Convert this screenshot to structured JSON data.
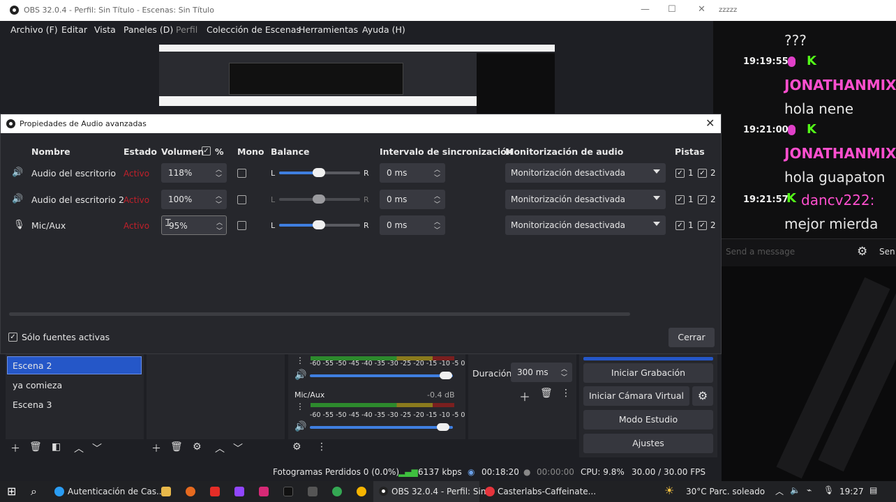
{
  "obs": {
    "title": "OBS 32.0.4 - Perfil: Sin Título - Escenas: Sin Título",
    "menu": [
      "Archivo (F)",
      "Editar",
      "Vista",
      "Paneles (D)",
      "Perfil",
      "Colección de Escenas",
      "Herramientas",
      "Ayuda (H)"
    ]
  },
  "chat": {
    "window_title": "zzzzz",
    "lines": [
      {
        "time": "",
        "user": "",
        "text": "???"
      },
      {
        "time": "19:19:55",
        "user": "JONATHANMIXI",
        "text": "hola nene"
      },
      {
        "time": "19:21:00",
        "user": "JONATHANMIXI",
        "text": "hola guapaton"
      },
      {
        "time": "19:21:57",
        "user": "dancv222:",
        "text": "mejor mierda"
      }
    ],
    "placeholder": "Send a message",
    "send_label": "Sen",
    "user_color": "#ff4fcf",
    "user2_color": "#ff4fcf"
  },
  "dialog": {
    "title": "Propiedades de Audio avanzadas",
    "headers": {
      "name": "Nombre",
      "estado": "Estado",
      "volumen": "Volumen",
      "pct": "%",
      "mono": "Mono",
      "balance": "Balance",
      "sync": "Intervalo de sincronización",
      "monitor": "Monitorización de audio",
      "tracks": "Pistas"
    },
    "rows": [
      {
        "name": "Audio del escritorio",
        "estado": "Activo",
        "volume": "118%",
        "balance_l": "L",
        "balance_r": "R",
        "sync": "0 ms",
        "monitor": "Monitorización desactivada",
        "track1": "1",
        "track2": "2"
      },
      {
        "name": "Audio del escritorio 2",
        "estado": "Activo",
        "volume": "100%",
        "balance_l": "L",
        "balance_r": "R",
        "sync": "0 ms",
        "monitor": "Monitorización desactivada",
        "track1": "1",
        "track2": "2"
      },
      {
        "name": "Mic/Aux",
        "estado": "Activo",
        "volume": "95%",
        "balance_l": "L",
        "balance_r": "R",
        "sync": "0 ms",
        "monitor": "Monitorización desactivada",
        "track1": "1",
        "track2": "2"
      }
    ],
    "active_only": "Sólo fuentes activas",
    "close": "Cerrar"
  },
  "scenes": [
    "Escena 2",
    "ya comieza",
    "Escena 3"
  ],
  "mixer": {
    "scale": "-60 -55 -50 -45 -40 -35 -30 -25 -20 -15 -10 -5  0",
    "mic_label": "Mic/Aux",
    "mic_db": "-0.4 dB"
  },
  "transition": {
    "duration_label": "Duración",
    "duration_value": "300 ms"
  },
  "controls": {
    "record": "Iniciar Grabación",
    "virtual_cam": "Iniciar Cámara Virtual",
    "studio": "Modo Estudio",
    "settings": "Ajustes"
  },
  "status": {
    "dropped": "Fotogramas Perdidos 0 (0.0%)",
    "kbps": "6137 kbps",
    "stream_time": "00:18:20",
    "rec_time": "00:00:00",
    "cpu": "CPU: 9.8%",
    "fps": "30.00 / 30.00 FPS"
  },
  "taskbar": {
    "app1": "Autenticación de Cas...",
    "app2": "OBS 32.0.4 - Perfil: Sin...",
    "app3": "Casterlabs-Caffeinate...",
    "weather": "30°C  Parc. soleado",
    "time": "19:27"
  }
}
